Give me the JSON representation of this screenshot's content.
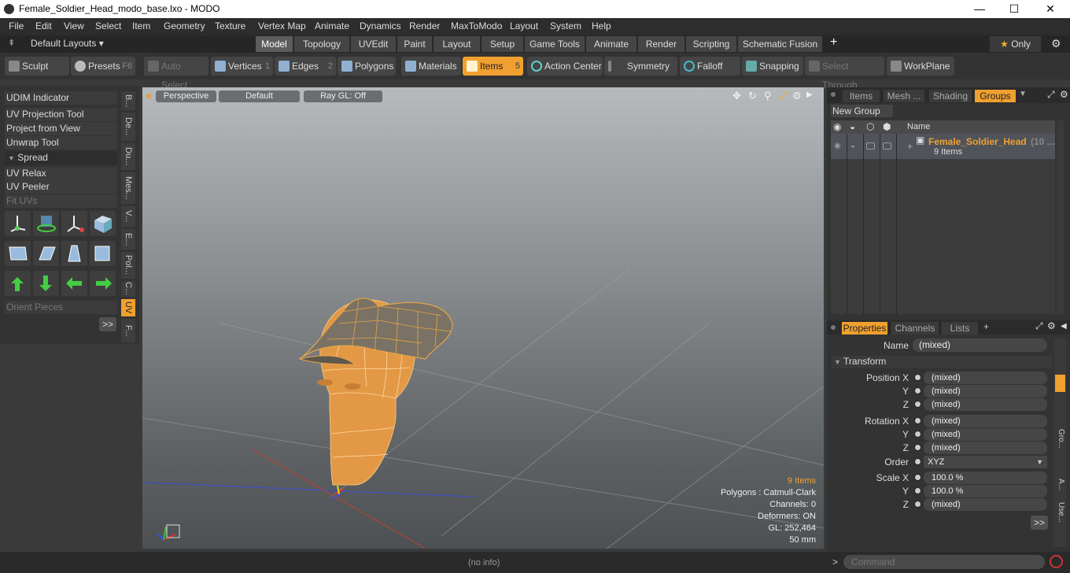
{
  "window": {
    "title": "Female_Soldier_Head_modo_base.lxo - MODO",
    "minimize": "—",
    "maximize": "☐",
    "close": "✕"
  },
  "menu": [
    "File",
    "Edit",
    "View",
    "Select",
    "Item",
    "Geometry",
    "Texture",
    "Vertex Map",
    "Animate",
    "Dynamics",
    "Render",
    "MaxToModo",
    "Layout",
    "System",
    "Help"
  ],
  "layoutbar": {
    "layouts_label": "Default Layouts ▾",
    "tabs": [
      "Model",
      "Topology",
      "UVEdit",
      "Paint",
      "Layout",
      "Setup",
      "Game Tools",
      "Animate",
      "Render",
      "Scripting",
      "Schematic Fusion"
    ],
    "add": "+",
    "only": "Only",
    "star": "★"
  },
  "toolbar": {
    "sculpt": "Sculpt",
    "presets": "Presets",
    "presets_key": "F6",
    "auto_select": "Auto Select",
    "vertices": "Vertices",
    "vertices_key": "1",
    "edges": "Edges",
    "edges_key": "2",
    "polygons": "Polygons",
    "materials": "Materials",
    "items": "Items",
    "items_key": "5",
    "action_center": "Action Center",
    "symmetry": "Symmetry",
    "falloff": "Falloff",
    "snapping": "Snapping",
    "select_through": "Select Through",
    "workplane": "WorkPlane"
  },
  "leftpanel": {
    "buttons": [
      "UDIM Indicator",
      "UV Projection Tool",
      "Project from View",
      "Unwrap Tool"
    ],
    "spread": "Spread",
    "buttons2": [
      "UV Relax",
      "UV Peeler",
      "Fit UVs"
    ],
    "orient": "Orient Pieces",
    "more": ">>",
    "vtabs": [
      "B...",
      "De...",
      "Du...",
      "Mes...",
      "V...",
      "E...",
      "Pol...",
      "C...",
      "UV",
      "F..."
    ]
  },
  "viewport": {
    "perspective": "Perspective",
    "default": "Default",
    "raygl": "Ray GL: Off",
    "info": {
      "items": "9 Items",
      "polygons": "Polygons : Catmull-Clark",
      "channels": "Channels: 0",
      "deformers": "Deformers: ON",
      "gl": "GL: 252,464",
      "scale": "50 mm"
    },
    "axis_x": "x",
    "axis_y": "y",
    "axis_z": "z"
  },
  "groups": {
    "tabs": [
      "Items",
      "Mesh ...",
      "Shading",
      "Groups"
    ],
    "new_group": "New Group",
    "col_name": "Name",
    "group_name": "Female_Soldier_Head",
    "group_count_suffix": "(10 ...",
    "group_items": "9 Items"
  },
  "properties": {
    "tabs": [
      "Properties",
      "Channels",
      "Lists"
    ],
    "add": "+",
    "name_label": "Name",
    "name_value": "(mixed)",
    "transform": "Transform",
    "pos_label": "Position X",
    "pos": [
      "(mixed)",
      "(mixed)",
      "(mixed)"
    ],
    "rot_label": "Rotation X",
    "rot": [
      "(mixed)",
      "(mixed)",
      "(mixed)"
    ],
    "order_label": "Order",
    "order_value": "XYZ",
    "scale_label": "Scale X",
    "scale": [
      "100.0 %",
      "100.0 %",
      "(mixed)"
    ],
    "y": "Y",
    "z": "Z",
    "more": ">>",
    "side_tabs": [
      "Gro...",
      "A...",
      "Use..."
    ]
  },
  "status": {
    "info": "(no info)",
    "command_placeholder": "Command",
    "prompt": ">"
  }
}
